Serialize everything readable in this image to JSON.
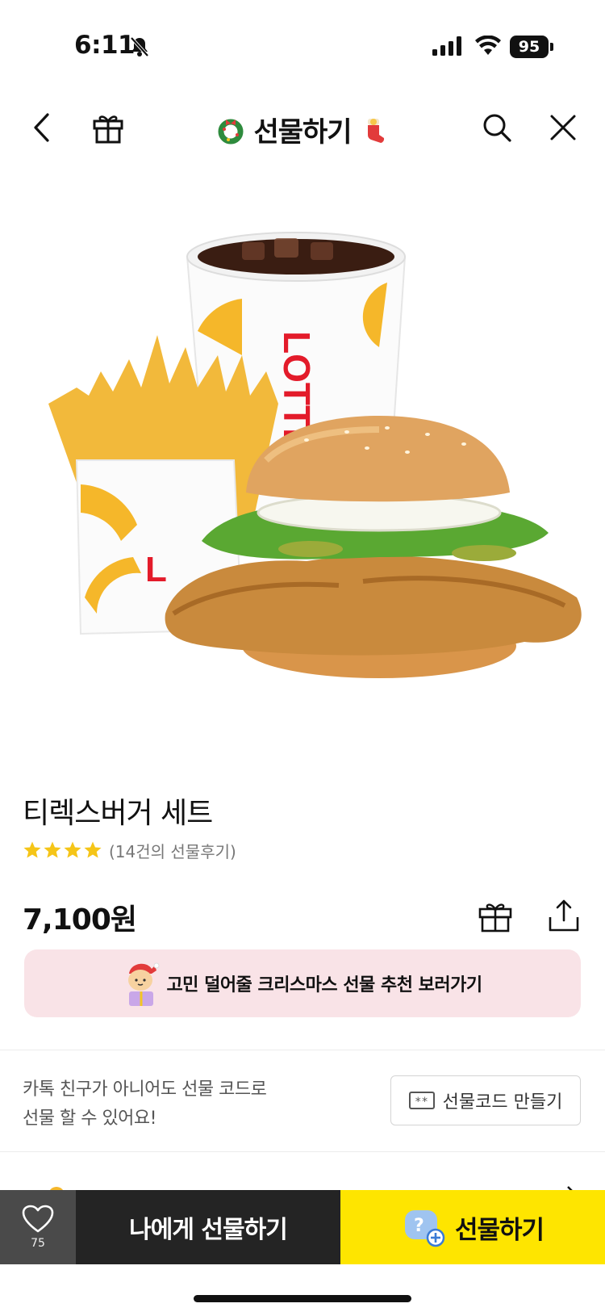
{
  "status_bar": {
    "time": "6:11",
    "battery": "95"
  },
  "header": {
    "title": "선물하기"
  },
  "product": {
    "name": "티렉스버거 세트",
    "rating_stars": 4,
    "review_count": "(14건의 선물후기)",
    "price": "7,100원"
  },
  "promo_banner": {
    "text": "고민 덜어줄 크리스마스 선물 추천 보러가기"
  },
  "gift_code": {
    "line1": "카톡 친구가 아니어도 선물 코드로",
    "line2": "선물 할 수 있어요!",
    "button_label": "선물코드 만들기"
  },
  "bottom_bar": {
    "wish_count": "75",
    "self_gift_label": "나에게 선물하기",
    "gift_label": "선물하기"
  },
  "colors": {
    "accent_yellow": "#fee500",
    "banner_pink": "#f9e3e7",
    "dark_button": "#242424",
    "wish_bg": "#4a4a4a",
    "star": "#f5c518"
  }
}
